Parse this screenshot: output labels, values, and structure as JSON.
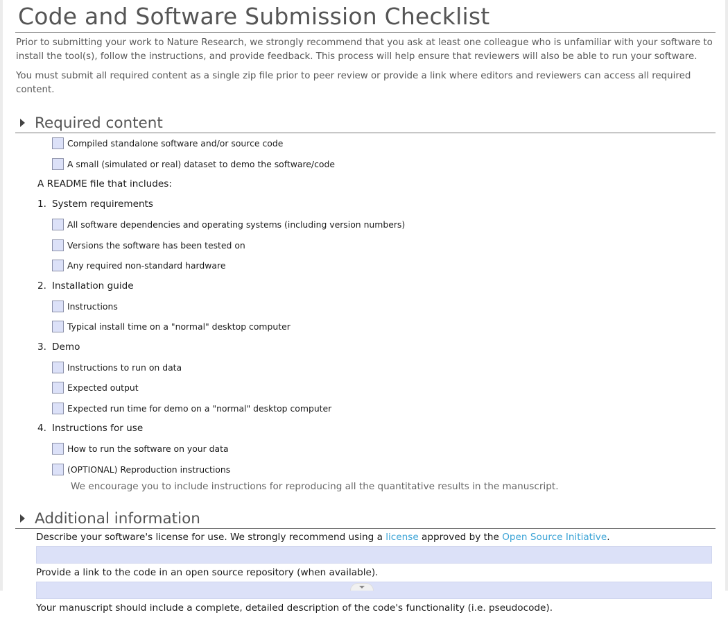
{
  "title": "Code and Software Submission Checklist",
  "intro": "Prior to submitting your work to Nature Research, we strongly recommend that you ask at least one colleague who is unfamiliar with your software to install the tool(s), follow the instructions, and provide feedback. This process will help ensure that reviewers will also be able to run your software.",
  "intro2": "You must submit all required content as a single zip file prior to peer review or provide a link where editors and reviewers can access all required content.",
  "required": {
    "heading": "Required content",
    "top_items": [
      "Compiled standalone software and/or source code",
      "A small (simulated or real) dataset to demo the software/code"
    ],
    "readme_label": "A README file that includes:",
    "groups": [
      {
        "num": "1.",
        "title": "System requirements",
        "items": [
          "All software dependencies and operating systems (including version numbers)",
          "Versions the software has been tested on",
          "Any required non-standard hardware"
        ]
      },
      {
        "num": "2.",
        "title": "Installation guide",
        "items": [
          "Instructions",
          "Typical install time on a \"normal\" desktop computer"
        ]
      },
      {
        "num": "3.",
        "title": "Demo",
        "items": [
          "Instructions to run on data",
          "Expected output",
          "Expected run time for demo on a \"normal\" desktop computer"
        ]
      },
      {
        "num": "4.",
        "title": "Instructions for use",
        "items": [
          "How to run the software on your data",
          "(OPTIONAL) Reproduction instructions"
        ]
      }
    ],
    "note": "We encourage you to include instructions for reproducing all the quantitative results in the manuscript."
  },
  "additional": {
    "heading": "Additional information",
    "license_pre": "Describe your software's license for use. We strongly recommend using a ",
    "license_link": "license",
    "license_mid": " approved by the ",
    "osi_link": "Open Source Initiative",
    "license_post": ".",
    "repo_label": "Provide a link to the code in an open source repository (when available).",
    "manuscript_label": "Your manuscript should include a complete, detailed description of the code's functionality (i.e. pseudocode)."
  }
}
